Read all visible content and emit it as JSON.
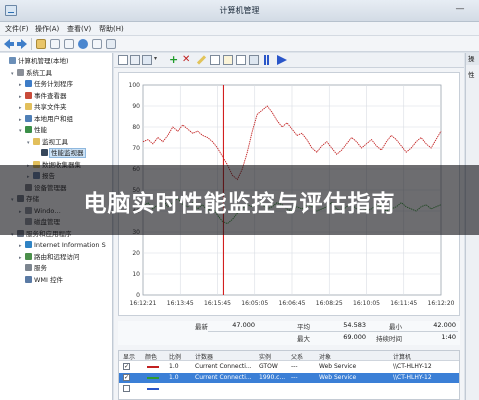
{
  "window": {
    "title": "计算机管理",
    "minimize_glyph": "—"
  },
  "menu": [
    "文件(F)",
    "操作(A)",
    "查看(V)",
    "帮助(H)"
  ],
  "tree": {
    "items": [
      {
        "label": "计算机管理(本地)",
        "level": 0,
        "expander": "",
        "icon": "computer-icon"
      },
      {
        "label": "系统工具",
        "level": 1,
        "expander": "▾",
        "icon": "tools-icon"
      },
      {
        "label": "任务计划程序",
        "level": 2,
        "expander": "▸",
        "icon": "clock-icon"
      },
      {
        "label": "事件查看器",
        "level": 2,
        "expander": "▸",
        "icon": "event-icon"
      },
      {
        "label": "共享文件夹",
        "level": 2,
        "expander": "▸",
        "icon": "folder-icon"
      },
      {
        "label": "本地用户和组",
        "level": 2,
        "expander": "▸",
        "icon": "users-icon"
      },
      {
        "label": "性能",
        "level": 2,
        "expander": "▾",
        "icon": "performance-icon"
      },
      {
        "label": "监视工具",
        "level": 3,
        "expander": "▾",
        "icon": "folder-icon"
      },
      {
        "label": "性能监视器",
        "level": 4,
        "expander": "",
        "icon": "monitor-icon",
        "selected": true
      },
      {
        "label": "数据收集器集",
        "level": 3,
        "expander": "▸",
        "icon": "folder-icon"
      },
      {
        "label": "报告",
        "level": 3,
        "expander": "▸",
        "icon": "report-icon"
      },
      {
        "label": "设备管理器",
        "level": 2,
        "expander": "",
        "icon": "device-icon"
      },
      {
        "label": "存储",
        "level": 1,
        "expander": "▾",
        "icon": "storage-icon"
      },
      {
        "label": "Windo…",
        "level": 2,
        "expander": "▸",
        "icon": "disk-icon"
      },
      {
        "label": "磁盘管理",
        "level": 2,
        "expander": "",
        "icon": "disk-icon"
      },
      {
        "label": "服务和应用程序",
        "level": 1,
        "expander": "▾",
        "icon": "services-icon"
      },
      {
        "label": "Internet Information S",
        "level": 2,
        "expander": "▸",
        "icon": "globe-icon"
      },
      {
        "label": "路由和远程访问",
        "level": 2,
        "expander": "▸",
        "icon": "routing-icon"
      },
      {
        "label": "服务",
        "level": 2,
        "expander": "",
        "icon": "gear-icon"
      },
      {
        "label": "WMI 控件",
        "level": 2,
        "expander": "",
        "icon": "wmi-icon"
      }
    ]
  },
  "chart_data": {
    "type": "line",
    "x": [
      "16:12:21",
      "16:13:45",
      "16:15:45",
      "16:05:05",
      "16:06:45",
      "16:08:25",
      "16:10:05",
      "16:11:45",
      "16:12:20"
    ],
    "ylim": [
      0,
      100
    ],
    "yticks": [
      0,
      10,
      20,
      30,
      40,
      50,
      60,
      70,
      80,
      90,
      100
    ],
    "grid": true,
    "cursor_position_fraction": 0.27,
    "series": [
      {
        "color": "#c22020",
        "values": [
          73,
          74,
          72,
          75,
          73,
          76,
          80,
          78,
          81,
          79,
          77,
          78,
          76,
          75,
          73,
          70,
          66,
          62,
          57,
          55,
          60,
          68,
          78,
          86,
          88,
          90,
          87,
          83,
          80,
          82,
          79,
          76,
          77,
          74,
          70,
          68,
          71,
          73,
          70,
          67,
          69,
          72,
          75,
          73,
          70,
          72,
          74,
          71,
          69,
          73,
          76,
          74,
          71,
          68,
          70,
          73,
          75,
          72,
          70,
          74,
          78
        ]
      },
      {
        "color": "#2f9a2f",
        "values": [
          42,
          44,
          41,
          43,
          45,
          42,
          44,
          46,
          43,
          42,
          44,
          41,
          43,
          40,
          42,
          38,
          35,
          34,
          36,
          39,
          41,
          43,
          42,
          44,
          43,
          41,
          42,
          44,
          43,
          41,
          40,
          42,
          41,
          43,
          42,
          40,
          41,
          42,
          44,
          41,
          40,
          42,
          43,
          41,
          42,
          40,
          41,
          43,
          42,
          40,
          41,
          42,
          44,
          42,
          41,
          40,
          42,
          43,
          41,
          42,
          43
        ]
      }
    ]
  },
  "stats": {
    "last_label": "最新",
    "last_value": "47.000",
    "avg_label": "平均",
    "avg_value": "54.583",
    "min_label": "最小",
    "min_value": "42.000",
    "max_label": "最大",
    "max_value": "69.000",
    "duration_label": "持续时间",
    "duration_value": "1:40"
  },
  "legend_table": {
    "headers": [
      "显示",
      "颜色",
      "比例",
      "计数器",
      "实例",
      "父系",
      "对象",
      "计算机"
    ],
    "rows": [
      {
        "checked": "✓",
        "color": "#c22020",
        "scale": "1.0",
        "counter": "Current Connecti...",
        "instance": "GTOW",
        "parent": "---",
        "object": "Web Service",
        "computer": "\\\\CT-HLHY-12",
        "selected": false
      },
      {
        "checked": "✓",
        "color": "#2f9a2f",
        "scale": "1.0",
        "counter": "Current Connecti...",
        "instance": "1990.c...",
        "parent": "---",
        "object": "Web Service",
        "computer": "\\\\CT-HLHY-12",
        "selected": true
      },
      {
        "checked": "",
        "color": "#2a56c9",
        "scale": "",
        "counter": "",
        "instance": "",
        "parent": "",
        "object": "",
        "computer": "",
        "selected": false
      }
    ]
  },
  "right_pane": {
    "header": "操",
    "item": "性"
  },
  "overlay": {
    "title": "电脑实时性能监控与评估指南"
  }
}
